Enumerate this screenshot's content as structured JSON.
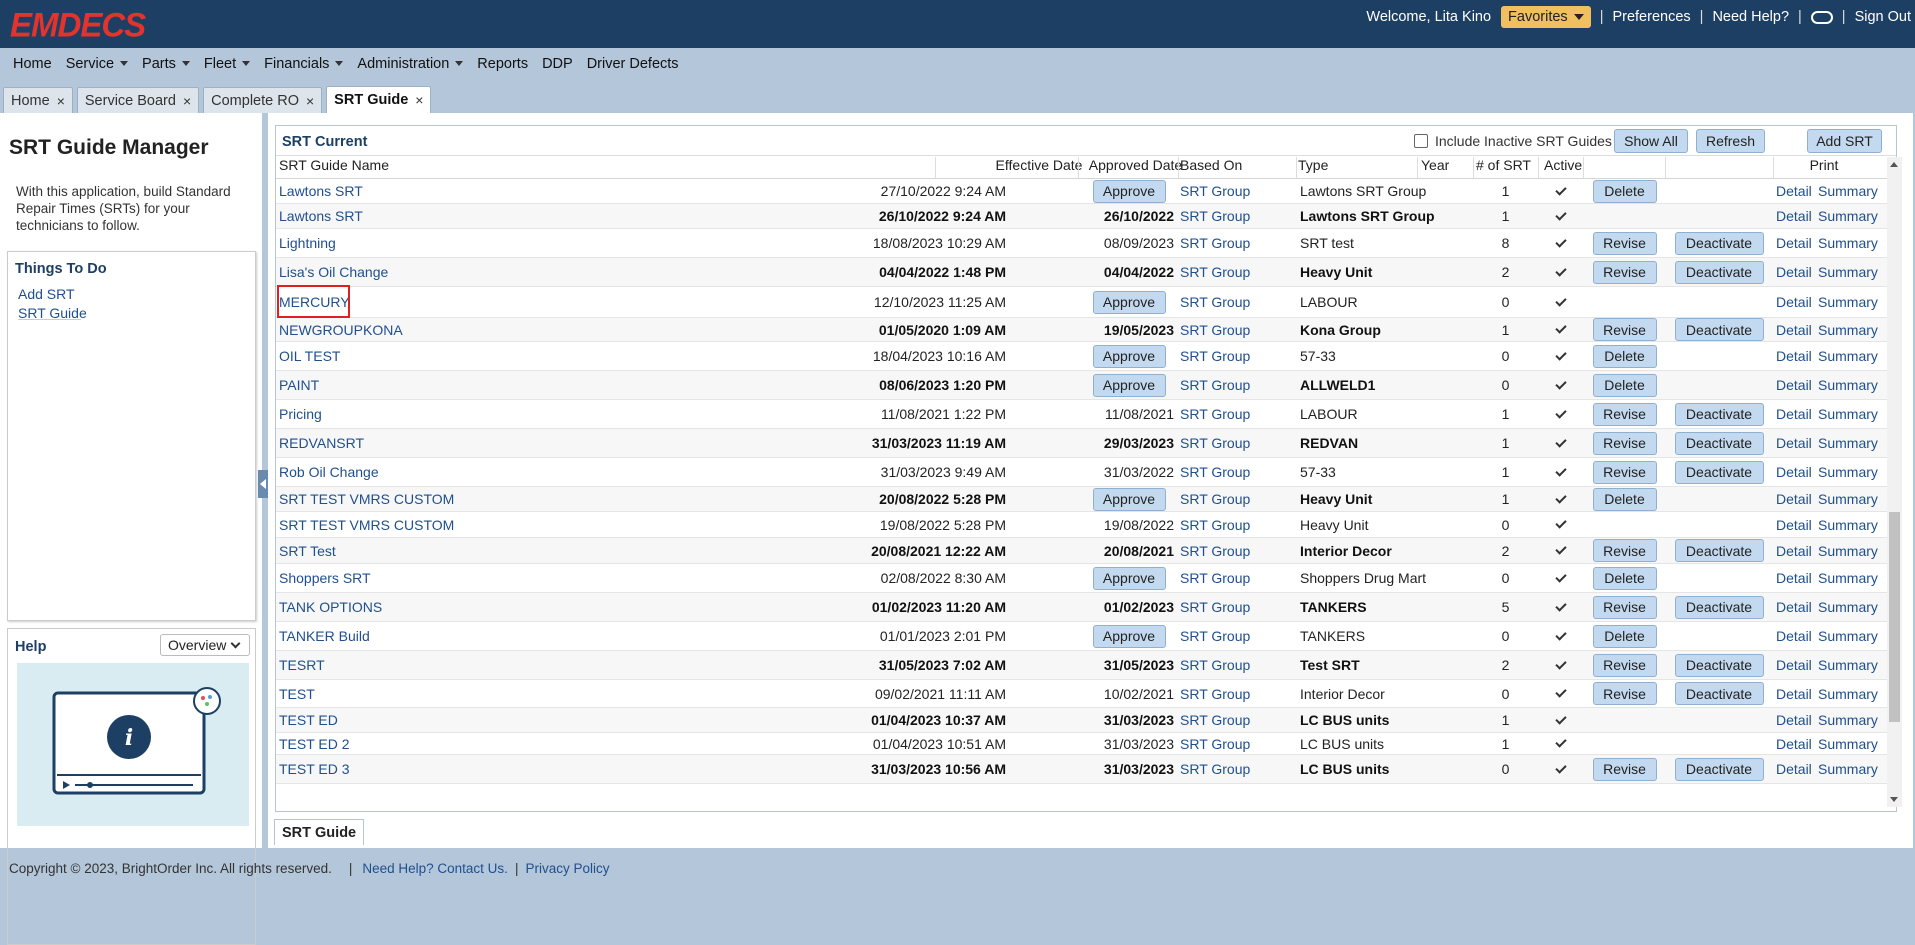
{
  "app": {
    "logo": "EMDECS"
  },
  "topbar": {
    "welcome": "Welcome, Lita Kino",
    "favorites": "Favorites",
    "preferences": "Preferences",
    "help": "Need Help?",
    "signout": "Sign Out",
    "sep": "|"
  },
  "menu": {
    "home": "Home",
    "service": "Service",
    "parts": "Parts",
    "fleet": "Fleet",
    "financials": "Financials",
    "administration": "Administration",
    "reports": "Reports",
    "ddp": "DDP",
    "driver_defects": "Driver Defects"
  },
  "tabs": {
    "home": "Home",
    "service_board": "Service Board",
    "complete_ro": "Complete RO",
    "srt_guide": "SRT Guide",
    "close": "×"
  },
  "left": {
    "title": "SRT Guide Manager",
    "description": "With this application, build Standard Repair Times (SRTs) for your technicians to follow.",
    "todo_title": "Things To Do",
    "add_srt": "Add SRT",
    "srt_guide": "SRT Guide",
    "help_title": "Help",
    "help_select": "Overview"
  },
  "grid": {
    "title": "SRT Current",
    "include_inactive": "Include Inactive SRT Guides",
    "show_all": "Show All",
    "refresh": "Refresh",
    "add_srt": "Add SRT",
    "columns": {
      "name": "SRT Guide Name",
      "effective": "Effective Date",
      "approved": "Approved Date",
      "based_on": "Based On",
      "type": "Type",
      "year": "Year",
      "count": "# of SRT",
      "active": "Active",
      "print": "Print"
    },
    "labels": {
      "approve": "Approve",
      "delete": "Delete",
      "revise": "Revise",
      "deactivate": "Deactivate",
      "detail": "Detail",
      "summary": "Summary"
    },
    "rows": [
      {
        "name": "Lawtons SRT",
        "eff": "27/10/2022 9:24 AM",
        "app": "",
        "based": "SRT Group",
        "type": "Lawtons SRT Group",
        "count": "1",
        "a1": "delete",
        "a2": "",
        "bold": false
      },
      {
        "name": "Lawtons SRT",
        "eff": "26/10/2022 9:24 AM",
        "app": "26/10/2022",
        "based": "SRT Group",
        "type": "Lawtons SRT Group",
        "count": "1",
        "a1": "",
        "a2": "",
        "bold": true
      },
      {
        "name": "Lightning",
        "eff": "18/08/2023 10:29 AM",
        "app": "08/09/2023",
        "based": "SRT Group",
        "type": "SRT test",
        "count": "8",
        "a1": "revise",
        "a2": "deactivate",
        "bold": false
      },
      {
        "name": "Lisa's Oil Change",
        "eff": "04/04/2022 1:48 PM",
        "app": "04/04/2022",
        "based": "SRT Group",
        "type": "Heavy Unit",
        "count": "2",
        "a1": "revise",
        "a2": "deactivate",
        "bold": true
      },
      {
        "name": "MERCURY",
        "eff": "12/10/2023 11:25 AM",
        "app": "",
        "based": "SRT Group",
        "type": "LABOUR",
        "count": "0",
        "a1": "",
        "a2": "",
        "bold": false,
        "highlight": true
      },
      {
        "name": "NEWGROUPKONA",
        "eff": "01/05/2020 1:09 AM",
        "app": "19/05/2023",
        "based": "SRT Group",
        "type": "Kona Group",
        "count": "1",
        "a1": "revise",
        "a2": "deactivate",
        "bold": true
      },
      {
        "name": "OIL TEST",
        "eff": "18/04/2023 10:16 AM",
        "app": "",
        "based": "SRT Group",
        "type": "57-33",
        "count": "0",
        "a1": "delete",
        "a2": "",
        "bold": false
      },
      {
        "name": "PAINT",
        "eff": "08/06/2023 1:20 PM",
        "app": "",
        "based": "SRT Group",
        "type": "ALLWELD1",
        "count": "0",
        "a1": "delete",
        "a2": "",
        "bold": true
      },
      {
        "name": "Pricing",
        "eff": "11/08/2021 1:22 PM",
        "app": "11/08/2021",
        "based": "SRT Group",
        "type": "LABOUR",
        "count": "1",
        "a1": "revise",
        "a2": "deactivate",
        "bold": false
      },
      {
        "name": "REDVANSRT",
        "eff": "31/03/2023 11:19 AM",
        "app": "29/03/2023",
        "based": "SRT Group",
        "type": "REDVAN",
        "count": "1",
        "a1": "revise",
        "a2": "deactivate",
        "bold": true
      },
      {
        "name": "Rob Oil Change",
        "eff": "31/03/2023 9:49 AM",
        "app": "31/03/2022",
        "based": "SRT Group",
        "type": "57-33",
        "count": "1",
        "a1": "revise",
        "a2": "deactivate",
        "bold": false
      },
      {
        "name": "SRT TEST VMRS CUSTOM",
        "eff": "20/08/2022 5:28 PM",
        "app": "",
        "based": "SRT Group",
        "type": "Heavy Unit",
        "count": "1",
        "a1": "delete",
        "a2": "",
        "bold": true
      },
      {
        "name": "SRT TEST VMRS CUSTOM",
        "eff": "19/08/2022 5:28 PM",
        "app": "19/08/2022",
        "based": "SRT Group",
        "type": "Heavy Unit",
        "count": "0",
        "a1": "",
        "a2": "",
        "bold": false
      },
      {
        "name": "SRT Test",
        "eff": "20/08/2021 12:22 AM",
        "app": "20/08/2021",
        "based": "SRT Group",
        "type": "Interior Decor",
        "count": "2",
        "a1": "revise",
        "a2": "deactivate",
        "bold": true
      },
      {
        "name": "Shoppers SRT",
        "eff": "02/08/2022 8:30 AM",
        "app": "",
        "based": "SRT Group",
        "type": "Shoppers Drug Mart",
        "count": "0",
        "a1": "delete",
        "a2": "",
        "bold": false
      },
      {
        "name": "TANK OPTIONS",
        "eff": "01/02/2023 11:20 AM",
        "app": "01/02/2023",
        "based": "SRT Group",
        "type": "TANKERS",
        "count": "5",
        "a1": "revise",
        "a2": "deactivate",
        "bold": true
      },
      {
        "name": "TANKER Build",
        "eff": "01/01/2023 2:01 PM",
        "app": "",
        "based": "SRT Group",
        "type": "TANKERS",
        "count": "0",
        "a1": "delete",
        "a2": "",
        "bold": false
      },
      {
        "name": "TESRT",
        "eff": "31/05/2023 7:02 AM",
        "app": "31/05/2023",
        "based": "SRT Group",
        "type": "Test SRT",
        "count": "2",
        "a1": "revise",
        "a2": "deactivate",
        "bold": true
      },
      {
        "name": "TEST",
        "eff": "09/02/2021 11:11 AM",
        "app": "10/02/2021",
        "based": "SRT Group",
        "type": "Interior Decor",
        "count": "0",
        "a1": "revise",
        "a2": "deactivate",
        "bold": false
      },
      {
        "name": "TEST ED",
        "eff": "01/04/2023 10:37 AM",
        "app": "31/03/2023",
        "based": "SRT Group",
        "type": "LC BUS units",
        "count": "1",
        "a1": "",
        "a2": "",
        "bold": true
      },
      {
        "name": "TEST ED 2",
        "eff": "01/04/2023 10:51 AM",
        "app": "31/03/2023",
        "based": "SRT Group",
        "type": "LC BUS units",
        "count": "1",
        "a1": "",
        "a2": "",
        "bold": false
      },
      {
        "name": "TEST ED 3",
        "eff": "31/03/2023 10:56 AM",
        "app": "31/03/2023",
        "based": "SRT Group",
        "type": "LC BUS units",
        "count": "0",
        "a1": "revise",
        "a2": "deactivate",
        "bold": true
      }
    ]
  },
  "bottom_tab": "SRT Guide",
  "footer": {
    "copyright": "Copyright © 2023, BrightOrder Inc. All rights reserved.",
    "sep": "|",
    "help_link": "Need Help? Contact Us.",
    "privacy": "Privacy Policy"
  }
}
